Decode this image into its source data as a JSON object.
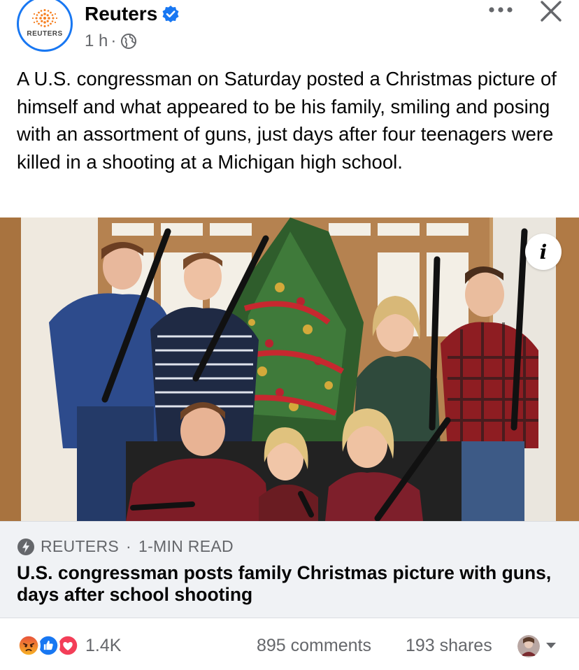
{
  "post": {
    "page_name": "Reuters",
    "avatar_text": "REUTERS",
    "time": "1 h",
    "separator": "·",
    "audience_icon": "globe-icon",
    "text": "A U.S. congressman on Saturday posted a Christmas picture of himself and what appeared to be his family, smiling and posing with an assortment of guns, just days after four teenagers were killed in a shooting at a Michigan high school."
  },
  "actions": {
    "more_icon": "more-options-icon",
    "close_icon": "close-icon"
  },
  "photo": {
    "info_label": "i"
  },
  "link_card": {
    "source": "REUTERS",
    "separator": "·",
    "read_time": "1-MIN READ",
    "headline": "U.S. congressman posts family Christmas picture with guns, days after school shooting"
  },
  "footer": {
    "reaction_icons": [
      "angry-reaction-icon",
      "like-reaction-icon",
      "love-reaction-icon"
    ],
    "reaction_count": "1.4K",
    "comments": "895 comments",
    "shares": "193 shares"
  },
  "colors": {
    "brand_blue": "#1877f2",
    "text_primary": "#050505",
    "text_secondary": "#65676b",
    "card_bg": "#f0f2f5",
    "reuters_orange": "#f57f20"
  }
}
